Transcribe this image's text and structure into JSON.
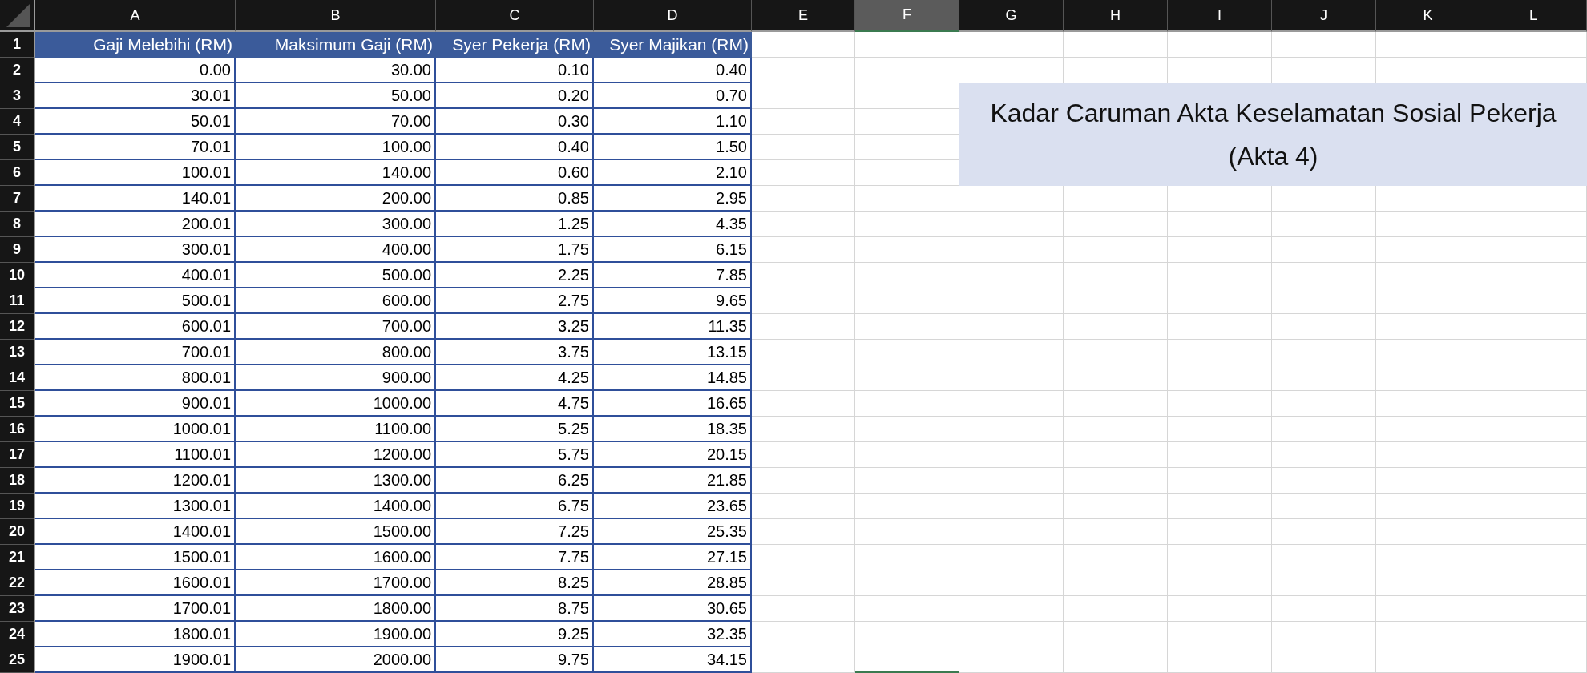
{
  "sheet": {
    "columns": [
      {
        "label": "A",
        "selected": false
      },
      {
        "label": "B",
        "selected": false
      },
      {
        "label": "C",
        "selected": false
      },
      {
        "label": "D",
        "selected": false
      },
      {
        "label": "E",
        "selected": false
      },
      {
        "label": "F",
        "selected": true
      },
      {
        "label": "G",
        "selected": false
      },
      {
        "label": "H",
        "selected": false
      },
      {
        "label": "I",
        "selected": false
      },
      {
        "label": "J",
        "selected": false
      },
      {
        "label": "K",
        "selected": false
      },
      {
        "label": "L",
        "selected": false
      }
    ],
    "header_row": {
      "number": "1",
      "cells": [
        "Gaji Melebihi (RM)",
        "Maksimum Gaji (RM)",
        "Syer Pekerja (RM)",
        "Syer Majikan (RM)"
      ]
    },
    "rows": [
      {
        "number": "2",
        "cells": [
          "0.00",
          "30.00",
          "0.10",
          "0.40"
        ]
      },
      {
        "number": "3",
        "cells": [
          "30.01",
          "50.00",
          "0.20",
          "0.70"
        ]
      },
      {
        "number": "4",
        "cells": [
          "50.01",
          "70.00",
          "0.30",
          "1.10"
        ]
      },
      {
        "number": "5",
        "cells": [
          "70.01",
          "100.00",
          "0.40",
          "1.50"
        ]
      },
      {
        "number": "6",
        "cells": [
          "100.01",
          "140.00",
          "0.60",
          "2.10"
        ]
      },
      {
        "number": "7",
        "cells": [
          "140.01",
          "200.00",
          "0.85",
          "2.95"
        ]
      },
      {
        "number": "8",
        "cells": [
          "200.01",
          "300.00",
          "1.25",
          "4.35"
        ]
      },
      {
        "number": "9",
        "cells": [
          "300.01",
          "400.00",
          "1.75",
          "6.15"
        ]
      },
      {
        "number": "10",
        "cells": [
          "400.01",
          "500.00",
          "2.25",
          "7.85"
        ]
      },
      {
        "number": "11",
        "cells": [
          "500.01",
          "600.00",
          "2.75",
          "9.65"
        ]
      },
      {
        "number": "12",
        "cells": [
          "600.01",
          "700.00",
          "3.25",
          "11.35"
        ]
      },
      {
        "number": "13",
        "cells": [
          "700.01",
          "800.00",
          "3.75",
          "13.15"
        ]
      },
      {
        "number": "14",
        "cells": [
          "800.01",
          "900.00",
          "4.25",
          "14.85"
        ]
      },
      {
        "number": "15",
        "cells": [
          "900.01",
          "1000.00",
          "4.75",
          "16.65"
        ]
      },
      {
        "number": "16",
        "cells": [
          "1000.01",
          "1100.00",
          "5.25",
          "18.35"
        ]
      },
      {
        "number": "17",
        "cells": [
          "1100.01",
          "1200.00",
          "5.75",
          "20.15"
        ]
      },
      {
        "number": "18",
        "cells": [
          "1200.01",
          "1300.00",
          "6.25",
          "21.85"
        ]
      },
      {
        "number": "19",
        "cells": [
          "1300.01",
          "1400.00",
          "6.75",
          "23.65"
        ]
      },
      {
        "number": "20",
        "cells": [
          "1400.01",
          "1500.00",
          "7.25",
          "25.35"
        ]
      },
      {
        "number": "21",
        "cells": [
          "1500.01",
          "1600.00",
          "7.75",
          "27.15"
        ]
      },
      {
        "number": "22",
        "cells": [
          "1600.01",
          "1700.00",
          "8.25",
          "28.85"
        ]
      },
      {
        "number": "23",
        "cells": [
          "1700.01",
          "1800.00",
          "8.75",
          "30.65"
        ]
      },
      {
        "number": "24",
        "cells": [
          "1800.01",
          "1900.00",
          "9.25",
          "32.35"
        ]
      },
      {
        "number": "25",
        "cells": [
          "1900.01",
          "2000.00",
          "9.75",
          "34.15"
        ]
      }
    ],
    "merged_title": {
      "text": "Kadar Caruman Akta Keselamatan Sosial Pekerja (Akta 4)"
    }
  }
}
